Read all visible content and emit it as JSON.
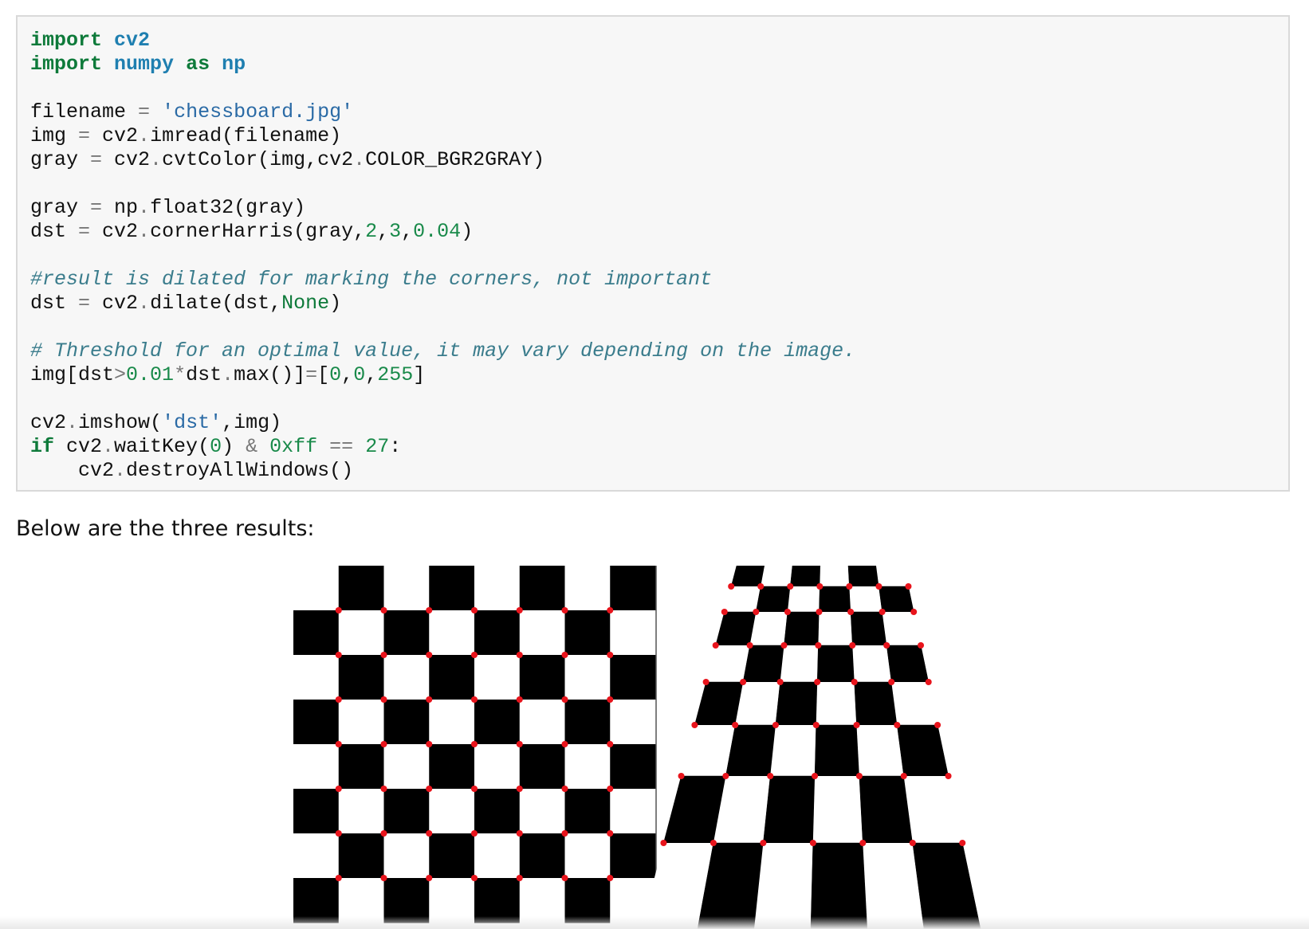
{
  "code": {
    "lines": [
      [
        {
          "t": "import",
          "c": "kw"
        },
        {
          "t": " "
        },
        {
          "t": "cv2",
          "c": "mod"
        }
      ],
      [
        {
          "t": "import",
          "c": "kw"
        },
        {
          "t": " "
        },
        {
          "t": "numpy",
          "c": "mod"
        },
        {
          "t": " "
        },
        {
          "t": "as",
          "c": "kw"
        },
        {
          "t": " "
        },
        {
          "t": "np",
          "c": "mod"
        }
      ],
      [],
      [
        {
          "t": "filename "
        },
        {
          "t": "=",
          "c": "op"
        },
        {
          "t": " "
        },
        {
          "t": "'chessboard.jpg'",
          "c": "str"
        }
      ],
      [
        {
          "t": "img "
        },
        {
          "t": "=",
          "c": "op"
        },
        {
          "t": " cv2"
        },
        {
          "t": ".",
          "c": "op"
        },
        {
          "t": "imread(filename)"
        }
      ],
      [
        {
          "t": "gray "
        },
        {
          "t": "=",
          "c": "op"
        },
        {
          "t": " cv2"
        },
        {
          "t": ".",
          "c": "op"
        },
        {
          "t": "cvtColor(img,cv2"
        },
        {
          "t": ".",
          "c": "op"
        },
        {
          "t": "COLOR_BGR2GRAY)"
        }
      ],
      [],
      [
        {
          "t": "gray "
        },
        {
          "t": "=",
          "c": "op"
        },
        {
          "t": " np"
        },
        {
          "t": ".",
          "c": "op"
        },
        {
          "t": "float32(gray)"
        }
      ],
      [
        {
          "t": "dst "
        },
        {
          "t": "=",
          "c": "op"
        },
        {
          "t": " cv2"
        },
        {
          "t": ".",
          "c": "op"
        },
        {
          "t": "cornerHarris(gray,"
        },
        {
          "t": "2",
          "c": "num"
        },
        {
          "t": ","
        },
        {
          "t": "3",
          "c": "num"
        },
        {
          "t": ","
        },
        {
          "t": "0.04",
          "c": "num"
        },
        {
          "t": ")"
        }
      ],
      [],
      [
        {
          "t": "#result is dilated for marking the corners, not important",
          "c": "comment"
        }
      ],
      [
        {
          "t": "dst "
        },
        {
          "t": "=",
          "c": "op"
        },
        {
          "t": " cv2"
        },
        {
          "t": ".",
          "c": "op"
        },
        {
          "t": "dilate(dst,"
        },
        {
          "t": "None",
          "c": "const"
        },
        {
          "t": ")"
        }
      ],
      [],
      [
        {
          "t": "# Threshold for an optimal value, it may vary depending on the image.",
          "c": "comment"
        }
      ],
      [
        {
          "t": "img[dst"
        },
        {
          "t": ">",
          "c": "op"
        },
        {
          "t": "0.01",
          "c": "num"
        },
        {
          "t": "*",
          "c": "op"
        },
        {
          "t": "dst"
        },
        {
          "t": ".",
          "c": "op"
        },
        {
          "t": "max()]"
        },
        {
          "t": "=",
          "c": "op"
        },
        {
          "t": "["
        },
        {
          "t": "0",
          "c": "num"
        },
        {
          "t": ","
        },
        {
          "t": "0",
          "c": "num"
        },
        {
          "t": ","
        },
        {
          "t": "255",
          "c": "num"
        },
        {
          "t": "]"
        }
      ],
      [],
      [
        {
          "t": "cv2"
        },
        {
          "t": ".",
          "c": "op"
        },
        {
          "t": "imshow("
        },
        {
          "t": "'dst'",
          "c": "str"
        },
        {
          "t": ",img)"
        }
      ],
      [
        {
          "t": "if",
          "c": "kw"
        },
        {
          "t": " cv2"
        },
        {
          "t": ".",
          "c": "op"
        },
        {
          "t": "waitKey("
        },
        {
          "t": "0",
          "c": "num"
        },
        {
          "t": ") "
        },
        {
          "t": "&",
          "c": "op"
        },
        {
          "t": " "
        },
        {
          "t": "0xff",
          "c": "num"
        },
        {
          "t": " "
        },
        {
          "t": "==",
          "c": "op"
        },
        {
          "t": " "
        },
        {
          "t": "27",
          "c": "num"
        },
        {
          "t": ":"
        }
      ],
      [
        {
          "t": "    cv2"
        },
        {
          "t": ".",
          "c": "op"
        },
        {
          "t": "destroyAllWindows()"
        }
      ]
    ]
  },
  "caption": "Below are the three results:",
  "results_image": {
    "flat_board": {
      "columns": 8,
      "rows": 8,
      "dark": "#000000",
      "light": "#ffffff",
      "corner_marker": "#e8141c"
    },
    "perspective_board": {
      "columns": 6,
      "rows": 8,
      "dark": "#000000",
      "light": "#ffffff",
      "corner_marker": "#e8141c"
    }
  }
}
